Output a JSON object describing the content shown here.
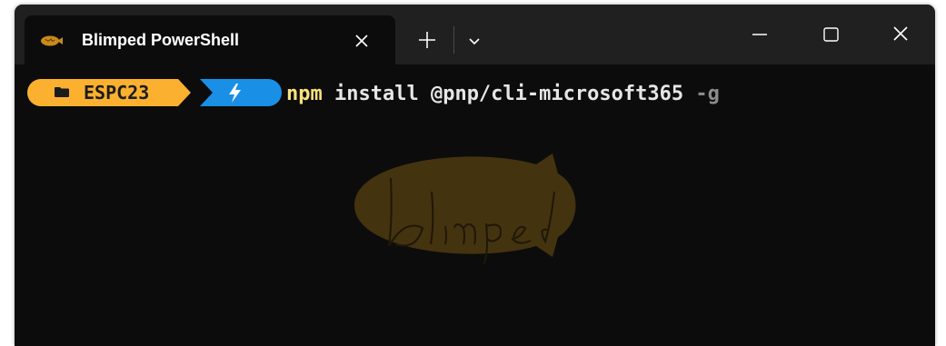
{
  "window": {
    "tab_title": "Blimped PowerShell",
    "tab_icon": "blimp-icon",
    "buttons": {
      "close_tab": "close-icon",
      "new_tab": "plus-icon",
      "dropdown": "chevron-down-icon",
      "minimize": "minimize-icon",
      "maximize": "maximize-icon",
      "close": "close-icon"
    }
  },
  "prompt": {
    "folder_icon": "folder-icon",
    "folder": "ESPC23",
    "status_icon": "lightning-bolt-icon",
    "colors": {
      "folder_segment": "#fbb02f",
      "status_segment": "#1a8fe6"
    }
  },
  "command": {
    "executable": "npm",
    "arguments": " install @pnp/cli-microsoft365 ",
    "flag": "-g",
    "colors": {
      "executable": "#f9e27d",
      "arguments": "#e6e6e6",
      "flag": "#8a8a8a"
    }
  },
  "background": {
    "watermark": "blimped-logo",
    "watermark_text": "blimped"
  }
}
